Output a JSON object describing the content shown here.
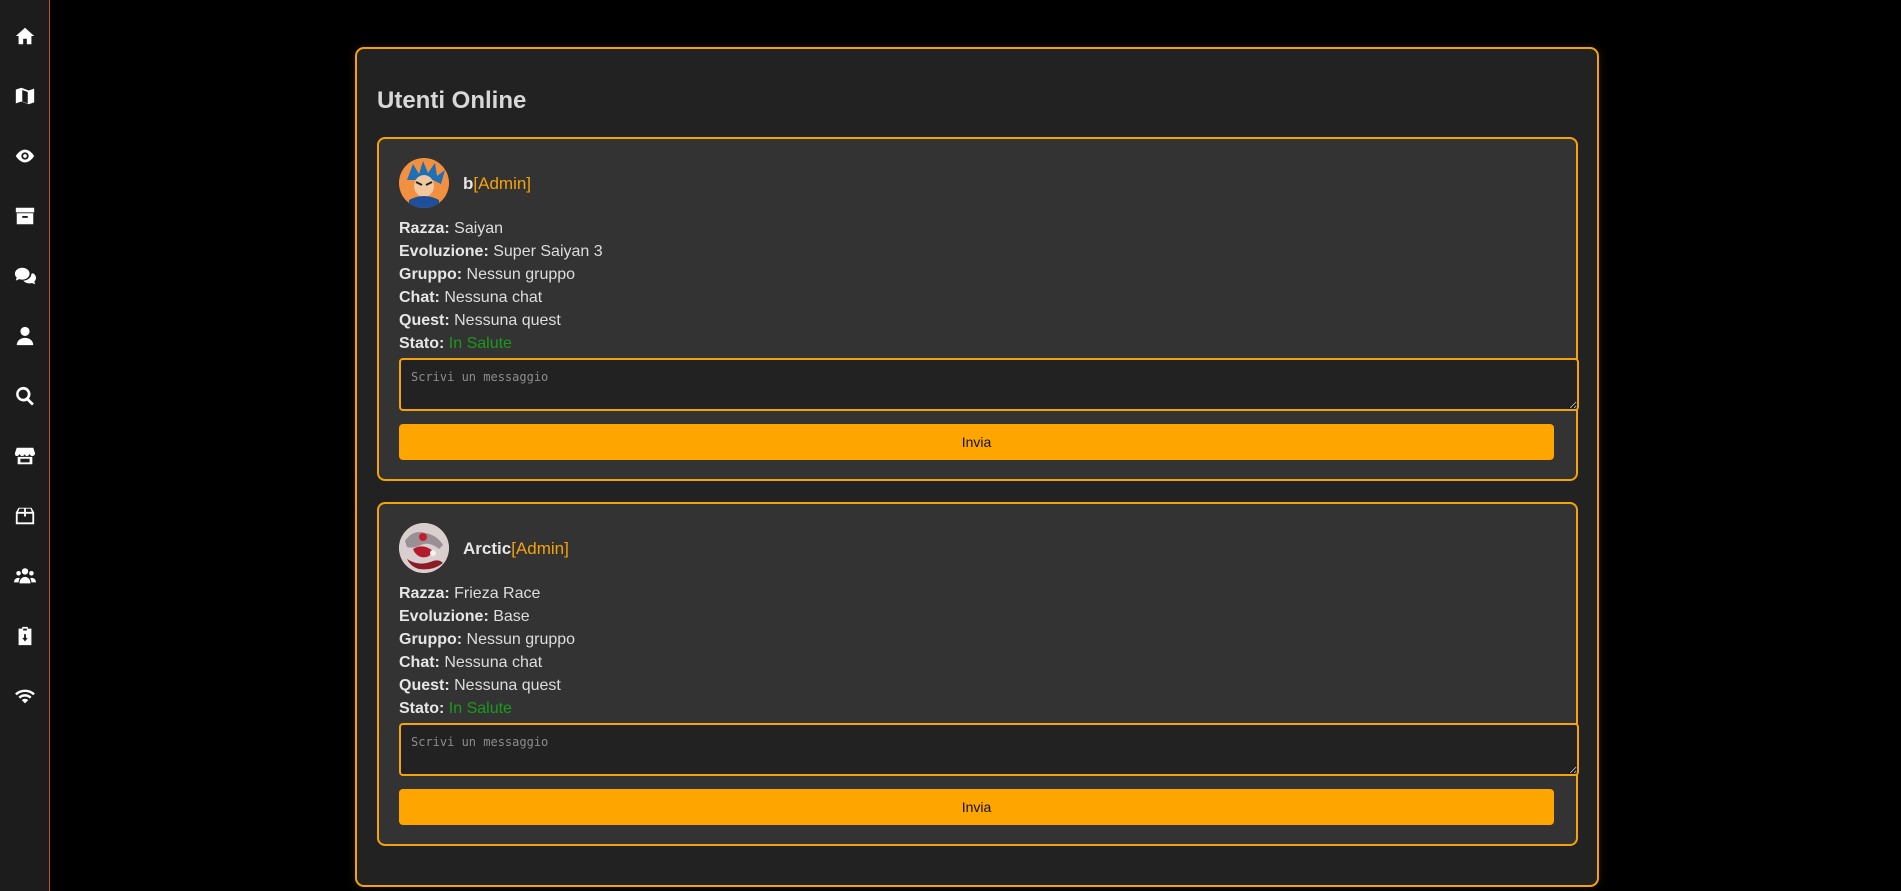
{
  "sidebar": {
    "icons": [
      "home-icon",
      "map-icon",
      "eye-icon",
      "archive-icon",
      "chat-icon",
      "user-icon",
      "search-icon",
      "store-icon",
      "box-icon",
      "users-icon",
      "clipboard-icon",
      "wifi-icon"
    ]
  },
  "panel": {
    "title": "Utenti Online"
  },
  "users": [
    {
      "name": "b",
      "role": "[Admin]",
      "razza_label": "Razza:",
      "razza": "Saiyan",
      "evoluzione_label": "Evoluzione:",
      "evoluzione": "Super Saiyan 3",
      "gruppo_label": "Gruppo:",
      "gruppo": "Nessun gruppo",
      "chat_label": "Chat:",
      "chat": "Nessuna chat",
      "quest_label": "Quest:",
      "quest": "Nessuna quest",
      "stato_label": "Stato:",
      "stato": "In Salute",
      "message_placeholder": "Scrivi un messaggio",
      "send_label": "Invia"
    },
    {
      "name": "Arctic",
      "role": "[Admin]",
      "razza_label": "Razza:",
      "razza": "Frieza Race",
      "evoluzione_label": "Evoluzione:",
      "evoluzione": "Base",
      "gruppo_label": "Gruppo:",
      "gruppo": "Nessun gruppo",
      "chat_label": "Chat:",
      "chat": "Nessuna chat",
      "quest_label": "Quest:",
      "quest": "Nessuna quest",
      "stato_label": "Stato:",
      "stato": "In Salute",
      "message_placeholder": "Scrivi un messaggio",
      "send_label": "Invia"
    }
  ],
  "colors": {
    "accent": "#f5a30a",
    "button": "#ffa500",
    "status_ok": "#1a9a1a",
    "panel_bg": "#222222",
    "card_bg": "#333333",
    "sidebar_border": "#c0522a"
  }
}
